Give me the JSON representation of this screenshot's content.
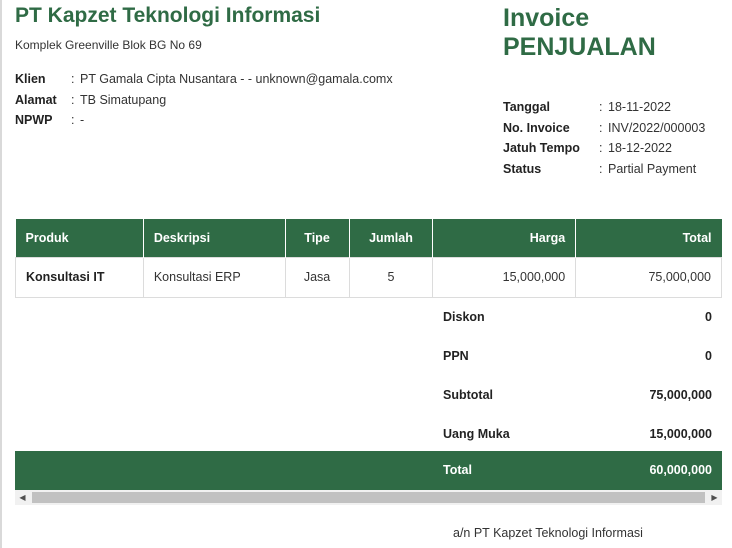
{
  "company": {
    "name": "PT Kapzet Teknologi Informasi",
    "address": "Komplek Greenville Blok BG No 69"
  },
  "client": {
    "rows": [
      {
        "label": "Klien",
        "value": "PT Gamala Cipta Nusantara - - unknown@gamala.comx"
      },
      {
        "label": "Alamat",
        "value": "TB Simatupang"
      },
      {
        "label": "NPWP",
        "value": "-"
      }
    ]
  },
  "invoice": {
    "title_line1": "Invoice",
    "title_line2": "PENJUALAN",
    "meta": [
      {
        "label": "Tanggal",
        "value": "18-11-2022"
      },
      {
        "label": "No. Invoice",
        "value": "INV/2022/000003"
      },
      {
        "label": "Jatuh Tempo",
        "value": "18-12-2022"
      },
      {
        "label": "Status",
        "value": "Partial Payment"
      }
    ]
  },
  "table": {
    "headers": [
      "Produk",
      "Deskripsi",
      "Tipe",
      "Jumlah",
      "Harga",
      "Total"
    ],
    "rows": [
      [
        "Konsultasi IT",
        "Konsultasi ERP",
        "Jasa",
        "5",
        "15,000,000",
        "75,000,000"
      ]
    ]
  },
  "summary": [
    {
      "label": "Diskon",
      "value": "0"
    },
    {
      "label": "PPN",
      "value": "0"
    },
    {
      "label": "Subtotal",
      "value": "75,000,000"
    },
    {
      "label": "Uang Muka",
      "value": "15,000,000"
    }
  ],
  "total": {
    "label": "Total",
    "value": "60,000,000"
  },
  "signature": "a/n PT Kapzet Teknologi Informasi",
  "colors": {
    "accent": "#2f6b45"
  }
}
